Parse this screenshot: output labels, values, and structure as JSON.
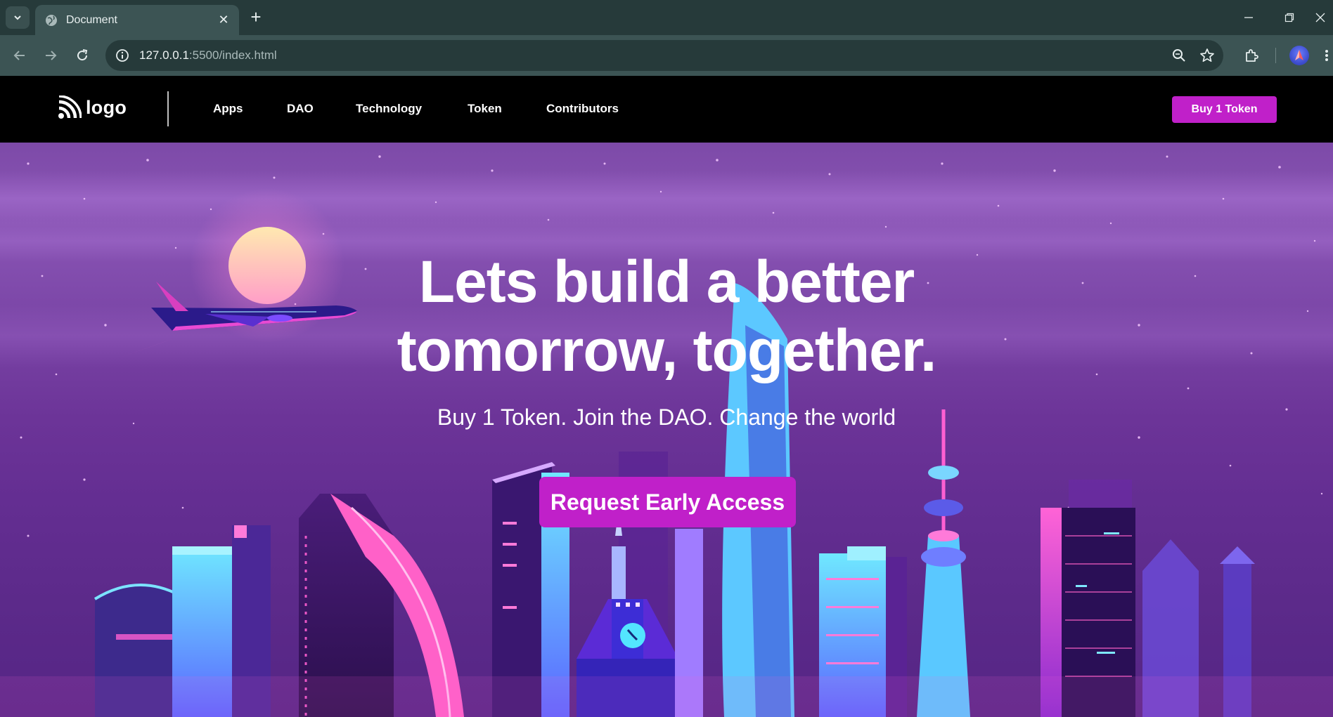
{
  "browser": {
    "tab": {
      "title": "Document",
      "icon": "globe-icon"
    },
    "address": {
      "host": "127.0.0.1",
      "path": ":5500/index.html"
    }
  },
  "site": {
    "logo": {
      "text": "logo",
      "icon": "rss-logo-icon"
    },
    "nav": [
      {
        "label": "Apps"
      },
      {
        "label": "DAO"
      },
      {
        "label": "Technology"
      },
      {
        "label": "Token"
      },
      {
        "label": "Contributors"
      }
    ],
    "buy_button": "Buy 1 Token"
  },
  "hero": {
    "headline_line1": "Lets build a better",
    "headline_line2": "tomorrow, together.",
    "subheadline": "Buy 1 Token. Join the DAO. Change the world",
    "cta": "Request Early Access"
  },
  "colors": {
    "accent": "#c020c9",
    "chrome_dark": "#263a3a",
    "chrome_light": "#3c5454"
  }
}
